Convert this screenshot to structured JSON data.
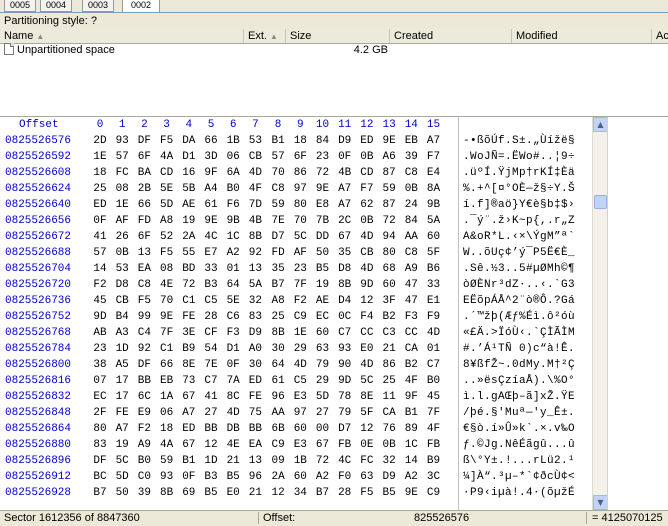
{
  "tabs": [
    "0005",
    "0004",
    "0003",
    "0002"
  ],
  "partitioning_style": "Partitioning style: ?",
  "columns": [
    {
      "label": "Name",
      "sorted": true
    },
    {
      "label": "Ext.",
      "sorted": true
    },
    {
      "label": "Size",
      "sorted": false
    },
    {
      "label": "Created",
      "sorted": false
    },
    {
      "label": "Modified",
      "sorted": false
    },
    {
      "label": "Ac",
      "sorted": false
    }
  ],
  "files": [
    {
      "name": "Unpartitioned space",
      "ext": "",
      "size": "4.2 GB",
      "created": "",
      "modified": ""
    }
  ],
  "hex": {
    "offset_label": "Offset",
    "columns": [
      "0",
      "1",
      "2",
      "3",
      "4",
      "5",
      "6",
      "7",
      "8",
      "9",
      "10",
      "11",
      "12",
      "13",
      "14",
      "15"
    ],
    "rows": [
      {
        "offset": "0825526576",
        "bytes": [
          "2D",
          "93",
          "DF",
          "F5",
          "DA",
          "66",
          "1B",
          "53",
          "B1",
          "18",
          "84",
          "D9",
          "ED",
          "9E",
          "EB",
          "A7"
        ],
        "text": "-•ßõÚf.S±.„Ùížë§"
      },
      {
        "offset": "0825526592",
        "bytes": [
          "1E",
          "57",
          "6F",
          "4A",
          "D1",
          "3D",
          "06",
          "CB",
          "57",
          "6F",
          "23",
          "0F",
          "0B",
          "A6",
          "39",
          "F7"
        ],
        "text": ".WoJÑ=.ËWo#..¦9÷"
      },
      {
        "offset": "0825526608",
        "bytes": [
          "18",
          "FC",
          "BA",
          "CD",
          "16",
          "9F",
          "6A",
          "4D",
          "70",
          "86",
          "72",
          "4B",
          "CD",
          "87",
          "C8",
          "E4"
        ],
        "text": ".üºÍ.ŸjMp†rKÍ‡Èä"
      },
      {
        "offset": "0825526624",
        "bytes": [
          "25",
          "08",
          "2B",
          "5E",
          "5B",
          "A4",
          "B0",
          "4F",
          "C8",
          "97",
          "9E",
          "A7",
          "F7",
          "59",
          "0B",
          "8A"
        ],
        "text": "%.+^[¤°OÈ—ž§÷Y.Š"
      },
      {
        "offset": "0825526640",
        "bytes": [
          "ED",
          "1E",
          "66",
          "5D",
          "AE",
          "61",
          "F6",
          "7D",
          "59",
          "80",
          "E8",
          "A7",
          "62",
          "87",
          "24",
          "9B"
        ],
        "text": "í.f]®aö}Y€è§b‡$›"
      },
      {
        "offset": "0825526656",
        "bytes": [
          "0F",
          "AF",
          "FD",
          "A8",
          "19",
          "9E",
          "9B",
          "4B",
          "7E",
          "70",
          "7B",
          "2C",
          "0B",
          "72",
          "84",
          "5A"
        ],
        "text": ".¯ý¨.ž›K~p{,.r„Z"
      },
      {
        "offset": "0825526672",
        "bytes": [
          "41",
          "26",
          "6F",
          "52",
          "2A",
          "4C",
          "1C",
          "8B",
          "D7",
          "5C",
          "DD",
          "67",
          "4D",
          "94",
          "AA",
          "60"
        ],
        "text": "A&oR*L.‹×\\ÝgM”ª`"
      },
      {
        "offset": "0825526688",
        "bytes": [
          "57",
          "0B",
          "13",
          "F5",
          "55",
          "E7",
          "A2",
          "92",
          "FD",
          "AF",
          "50",
          "35",
          "CB",
          "80",
          "C8",
          "5F"
        ],
        "text": "W..õUç¢’ý¯P5Ë€È_"
      },
      {
        "offset": "0825526704",
        "bytes": [
          "14",
          "53",
          "EA",
          "08",
          "BD",
          "33",
          "01",
          "13",
          "35",
          "23",
          "B5",
          "D8",
          "4D",
          "68",
          "A9",
          "B6"
        ],
        "text": ".Sê.½3..5#µØMh©¶"
      },
      {
        "offset": "0825526720",
        "bytes": [
          "F2",
          "D8",
          "C8",
          "4E",
          "72",
          "B3",
          "64",
          "5A",
          "B7",
          "7F",
          "19",
          "8B",
          "9D",
          "60",
          "47",
          "33"
        ],
        "text": "òØÈNr³dZ·..‹.`G3"
      },
      {
        "offset": "0825526736",
        "bytes": [
          "45",
          "CB",
          "F5",
          "70",
          "C1",
          "C5",
          "5E",
          "32",
          "A8",
          "F2",
          "AE",
          "D4",
          "12",
          "3F",
          "47",
          "E1"
        ],
        "text": "EËõpÁÅ^2¨ò®Ô.?Gá"
      },
      {
        "offset": "0825526752",
        "bytes": [
          "9D",
          "B4",
          "99",
          "9E",
          "FE",
          "28",
          "C6",
          "83",
          "25",
          "C9",
          "EC",
          "0C",
          "F4",
          "B2",
          "F3",
          "F9"
        ],
        "text": ".´™žþ(Æƒ%Éì.ô²óù"
      },
      {
        "offset": "0825526768",
        "bytes": [
          "AB",
          "A3",
          "C4",
          "7F",
          "3E",
          "CF",
          "F3",
          "D9",
          "8B",
          "1E",
          "60",
          "C7",
          "CC",
          "C3",
          "CC",
          "4D"
        ],
        "text": "«£Ä.>ÏóÙ‹.`ÇÌÃÌM"
      },
      {
        "offset": "0825526784",
        "bytes": [
          "23",
          "1D",
          "92",
          "C1",
          "B9",
          "54",
          "D1",
          "A0",
          "30",
          "29",
          "63",
          "93",
          "E0",
          "21",
          "CA",
          "01"
        ],
        "text": "#.’Á¹TÑ 0)c“à!Ê."
      },
      {
        "offset": "0825526800",
        "bytes": [
          "38",
          "A5",
          "DF",
          "66",
          "8E",
          "7E",
          "0F",
          "30",
          "64",
          "4D",
          "79",
          "90",
          "4D",
          "86",
          "B2",
          "C7"
        ],
        "text": "8¥ßfŽ~.0dMy.M†²Ç"
      },
      {
        "offset": "0825526816",
        "bytes": [
          "07",
          "17",
          "BB",
          "EB",
          "73",
          "C7",
          "7A",
          "ED",
          "61",
          "C5",
          "29",
          "9D",
          "5C",
          "25",
          "4F",
          "B0"
        ],
        "text": "..»ësÇzíaÅ).\\%O°"
      },
      {
        "offset": "0825526832",
        "bytes": [
          "EC",
          "17",
          "6C",
          "1A",
          "67",
          "41",
          "8C",
          "FE",
          "96",
          "E3",
          "5D",
          "78",
          "8E",
          "11",
          "9F",
          "45"
        ],
        "text": "ì.l.gAŒþ–ã]xŽ.ŸE"
      },
      {
        "offset": "0825526848",
        "bytes": [
          "2F",
          "FE",
          "E9",
          "06",
          "A7",
          "27",
          "4D",
          "75",
          "AA",
          "97",
          "27",
          "79",
          "5F",
          "CA",
          "B1",
          "7F"
        ],
        "text": "/þé.§'Muª—'y_Ê±."
      },
      {
        "offset": "0825526864",
        "bytes": [
          "80",
          "A7",
          "F2",
          "18",
          "ED",
          "BB",
          "DB",
          "BB",
          "6B",
          "60",
          "00",
          "D7",
          "12",
          "76",
          "89",
          "4F"
        ],
        "text": "€§ò.í»Û»k`.×.v‰O"
      },
      {
        "offset": "0825526880",
        "bytes": [
          "83",
          "19",
          "A9",
          "4A",
          "67",
          "12",
          "4E",
          "EA",
          "C9",
          "E3",
          "67",
          "FB",
          "0E",
          "0B",
          "1C",
          "FB"
        ],
        "text": "ƒ.©Jg.NêÉãgû...û"
      },
      {
        "offset": "0825526896",
        "bytes": [
          "DF",
          "5C",
          "B0",
          "59",
          "B1",
          "1D",
          "21",
          "13",
          "09",
          "1B",
          "72",
          "4C",
          "FC",
          "32",
          "14",
          "B9"
        ],
        "text": "ß\\°Y±.!...rLü2.¹"
      },
      {
        "offset": "0825526912",
        "bytes": [
          "BC",
          "5D",
          "C0",
          "93",
          "0F",
          "B3",
          "B5",
          "96",
          "2A",
          "60",
          "A2",
          "F0",
          "63",
          "D9",
          "A2",
          "3C"
        ],
        "text": "¼]À“.³µ–*`¢ðcÙ¢<"
      },
      {
        "offset": "0825526928",
        "bytes": [
          "B7",
          "50",
          "39",
          "8B",
          "69",
          "B5",
          "E0",
          "21",
          "12",
          "34",
          "B7",
          "28",
          "F5",
          "B5",
          "9E",
          "C9"
        ],
        "text": "·P9‹iµà!.4·(õµžÉ"
      }
    ]
  },
  "status": {
    "sector": "Sector 1612356 of 8847360",
    "offset_label": "Offset:",
    "offset_value": "825526576",
    "value": "= 4125070125"
  }
}
